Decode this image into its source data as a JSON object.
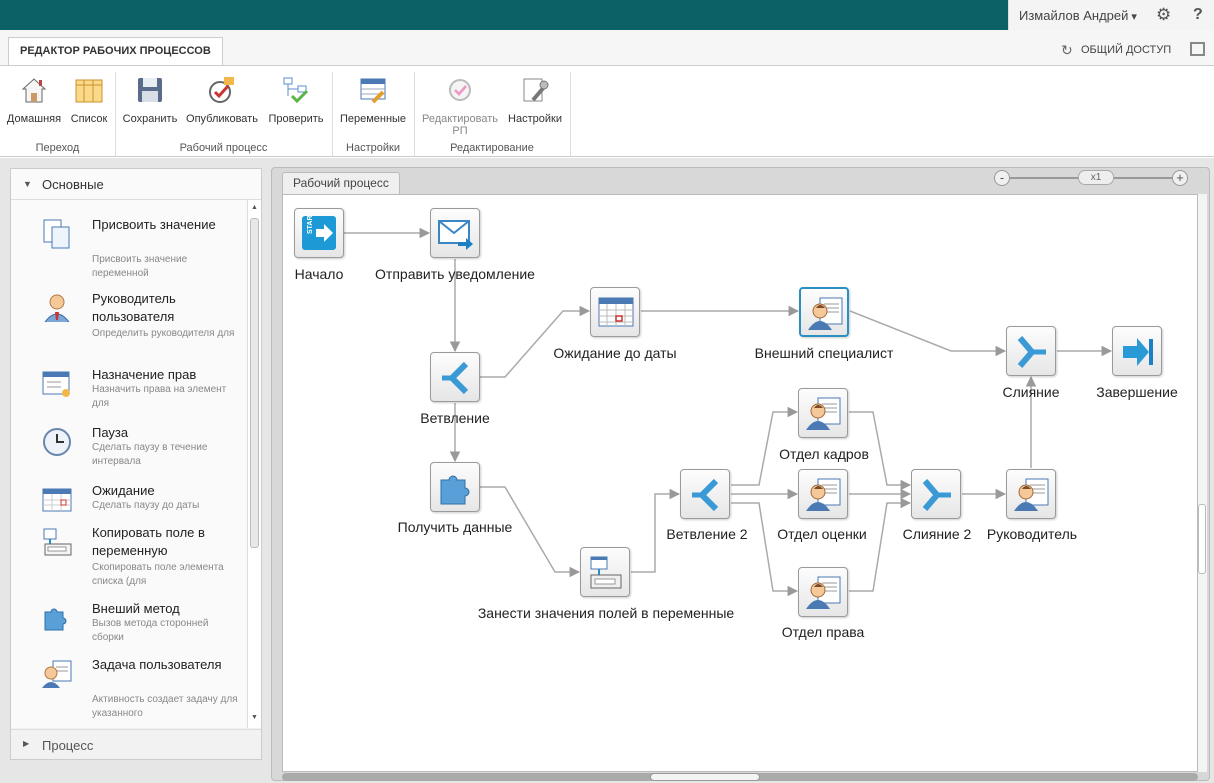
{
  "topbar": {
    "user": "Измайлов Андрей",
    "settings_icon": "gear-icon",
    "help": "?"
  },
  "ribbon_tab": "РЕДАКТОР РАБОЧИХ ПРОЦЕССОВ",
  "share": "ОБЩИЙ ДОСТУП",
  "ribbon": {
    "buttons": [
      "Домашняя",
      "Список",
      "Сохранить",
      "Опубликовать",
      "Проверить",
      "Переменные",
      "Редактировать РП",
      "Настройки"
    ],
    "groups": [
      "Переход",
      "Рабочий процесс",
      "Настройки",
      "Редактирование"
    ]
  },
  "left_panel": {
    "section_open": "Основные",
    "section_closed": "Процесс",
    "activities": [
      {
        "name": "Присвоить значение",
        "desc": "Присвоить значение переменной"
      },
      {
        "name": "Руководитель пользователя",
        "desc": "Определить руководителя для"
      },
      {
        "name": "Назначение прав",
        "desc": "Назначить права на элемент для"
      },
      {
        "name": "Пауза",
        "desc": "Сделать паузу в течение интервала"
      },
      {
        "name": "Ожидание",
        "desc": "Сделать паузу до даты"
      },
      {
        "name": "Копировать поле в переменную",
        "desc": "Скопировать поле элемента списка (для"
      },
      {
        "name": "Внеший метод",
        "desc": "Вызов метода сторонней сборки"
      },
      {
        "name": "Задача пользователя",
        "desc": "Активность создает задачу для указанного"
      }
    ]
  },
  "workflow": {
    "tab": "Рабочий процесс",
    "zoom": "x1",
    "zoom_minus": "-",
    "zoom_plus": "+",
    "nodes": [
      "Начало",
      "Отправить уведомление",
      "Ожидание до даты",
      "Внешний специалист",
      "Слияние",
      "Завершение",
      "Ветвление",
      "Отдел кадров",
      "Получить данные",
      "Ветвление 2",
      "Отдел оценки",
      "Слияние 2",
      "Руководитель",
      "Занести значения полей в переменные",
      "Отдел права"
    ]
  },
  "colors": {
    "topbar": "#0c6166",
    "accent": "#2a8fc3"
  }
}
